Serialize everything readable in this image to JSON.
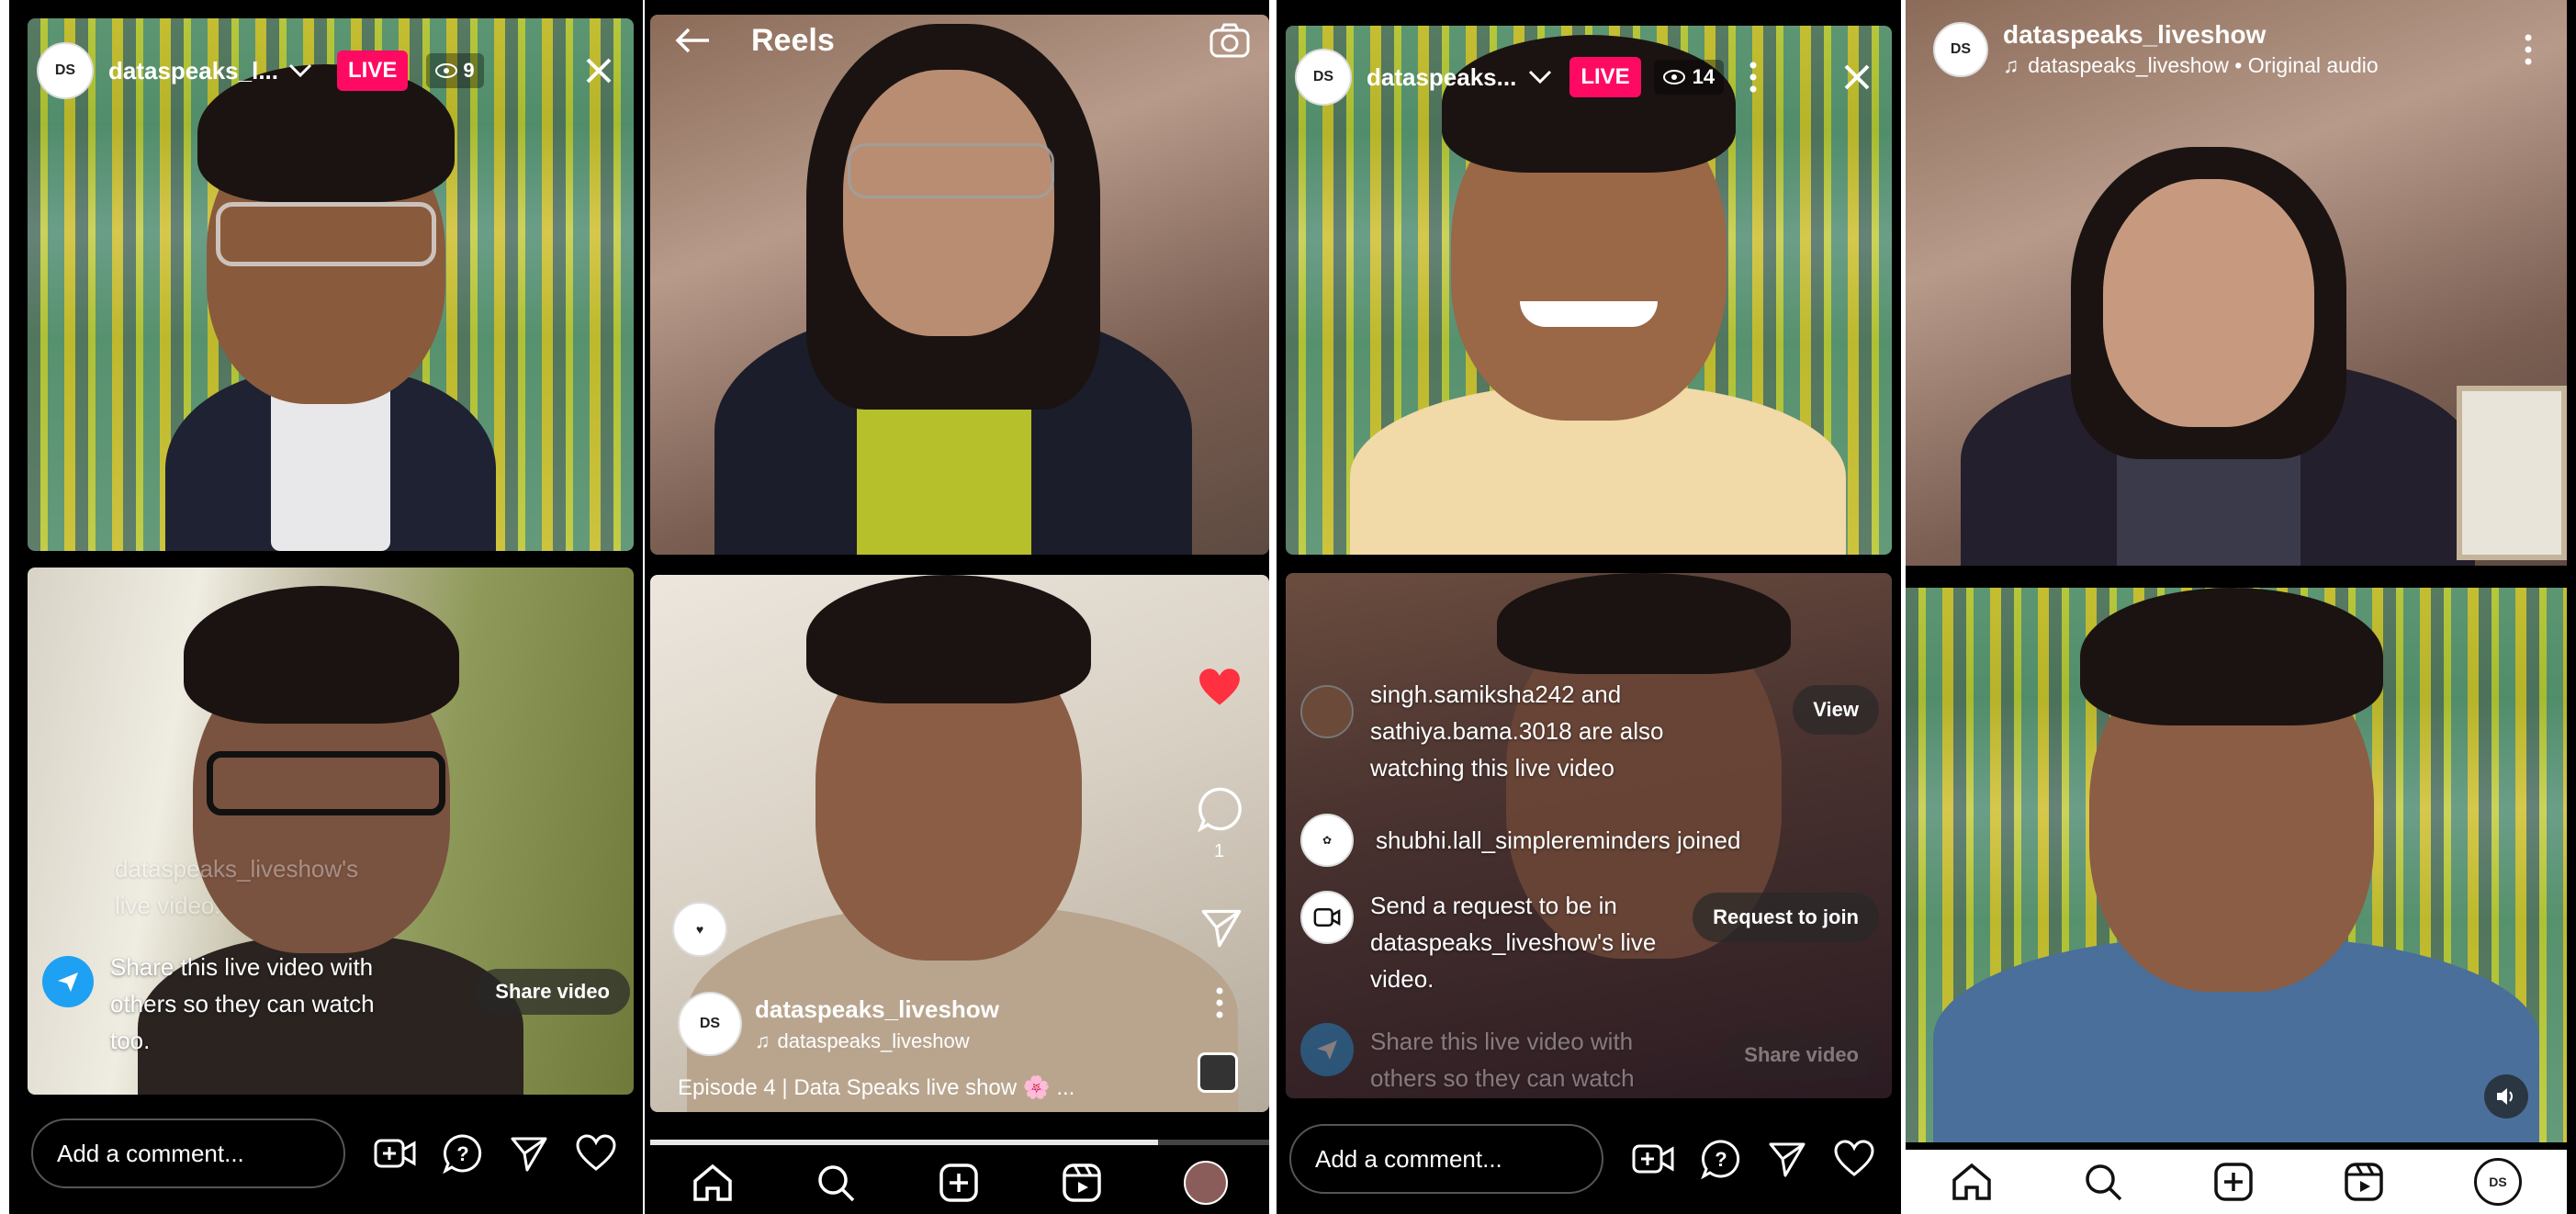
{
  "panel1": {
    "username": "dataspeaks_l...",
    "live_label": "LIVE",
    "viewer_count": "9",
    "ghost_text_1": "dataspeaks_liveshow's",
    "ghost_text_2": "live video.",
    "share_text": "Share this live video with others so they can watch too.",
    "share_button": "Share video",
    "comment_placeholder": "Add a comment..."
  },
  "panel2": {
    "header_title": "Reels",
    "username": "dataspeaks_liveshow",
    "audio": "dataspeaks_liveshow",
    "caption": "Episode 4 | Data Speaks live show 🌸 ...",
    "comment_count": "1",
    "progress": 0.82
  },
  "panel3": {
    "username": "dataspeaks...",
    "live_label": "LIVE",
    "viewer_count": "14",
    "notif_watching": "singh.samiksha242 and sathiya.bama.3018 are also watching this live video",
    "view_button": "View",
    "notif_joined": "shubhi.lall_simplereminders joined",
    "request_text": "Send a request to be in dataspeaks_liveshow's live video.",
    "request_button": "Request to join",
    "share_text": "Share this live video with others so they can watch",
    "share_button": "Share video",
    "comment_placeholder": "Add a comment..."
  },
  "panel4": {
    "username": "dataspeaks_liveshow",
    "audio": "dataspeaks_liveshow • Original audio"
  },
  "colors": {
    "live": "#ff0a63",
    "like": "#ff3040",
    "share_blue": "#1ea1f2"
  }
}
